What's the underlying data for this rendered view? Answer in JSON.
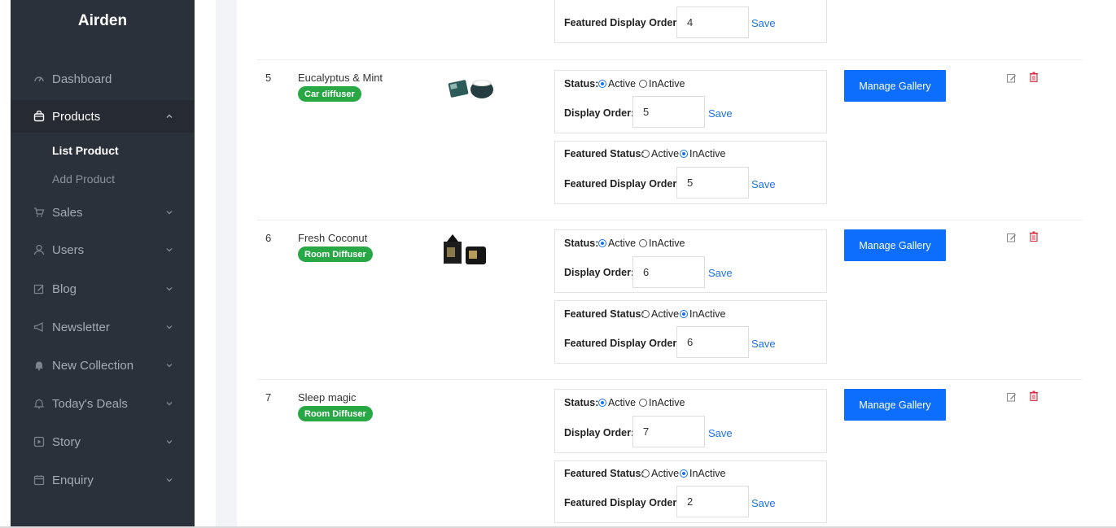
{
  "sidebar": {
    "brand": "Airden",
    "items": [
      {
        "label": "Dashboard",
        "icon": "dashboard-icon"
      },
      {
        "label": "Products",
        "icon": "shopping-bag-icon"
      },
      {
        "label": "Sales",
        "icon": "cart-icon"
      },
      {
        "label": "Users",
        "icon": "user-icon"
      },
      {
        "label": "Blog",
        "icon": "edit-icon"
      },
      {
        "label": "Newsletter",
        "icon": "megaphone-icon"
      },
      {
        "label": "New Collection",
        "icon": "bell-filled-icon"
      },
      {
        "label": "Today's Deals",
        "icon": "bell-icon"
      },
      {
        "label": "Story",
        "icon": "video-icon"
      },
      {
        "label": "Enquiry",
        "icon": "calendar-icon"
      }
    ],
    "sub_items": [
      {
        "label": "List Product"
      },
      {
        "label": "Add Product"
      }
    ]
  },
  "labels": {
    "status": "Status:",
    "active": "Active",
    "inactive": "InActive",
    "display_order": "Display Order:",
    "featured_status": "Featured Status:",
    "featured_display_order": "Featured Display Order:",
    "save": "Save",
    "manage_gallery": "Manage Gallery"
  },
  "rows": [
    {
      "featured_display_order": "4"
    },
    {
      "num": "5",
      "name": "Eucalyptus & Mint",
      "category": "Car diffuser",
      "status": "Active",
      "display_order": "5",
      "featured_status": "InActive",
      "featured_display_order": "5"
    },
    {
      "num": "6",
      "name": "Fresh Coconut",
      "category": "Room Diffuser",
      "status": "Active",
      "display_order": "6",
      "featured_status": "InActive",
      "featured_display_order": "6"
    },
    {
      "num": "7",
      "name": "Sleep magic",
      "category": "Room Diffuser",
      "status": "Active",
      "display_order": "7",
      "featured_status": "InActive",
      "featured_display_order": "2"
    }
  ],
  "colors": {
    "sidebar_bg": "#2b313a",
    "badge_green": "#28a745",
    "primary_blue": "#0d6efd",
    "delete_red": "#dc3545"
  }
}
